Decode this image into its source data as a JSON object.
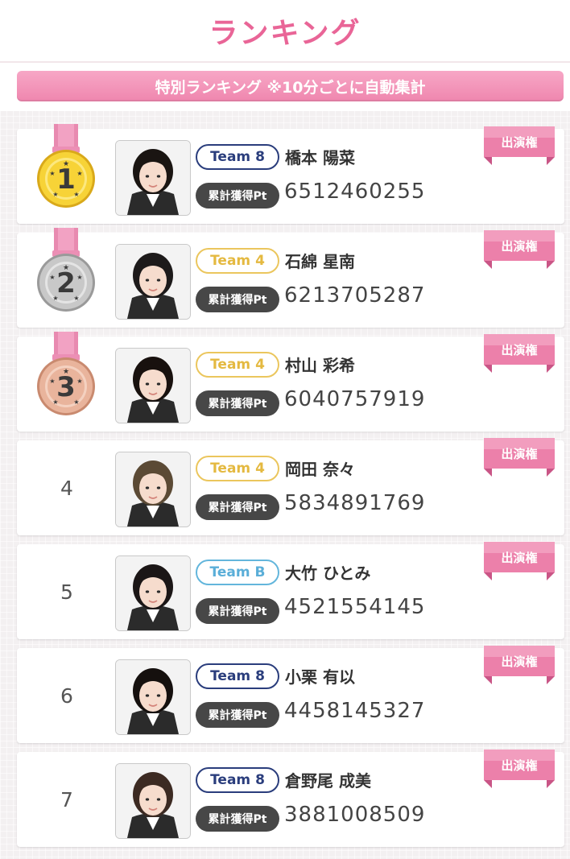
{
  "header": {
    "title": "ランキング"
  },
  "banner": {
    "text": "特別ランキング ※10分ごとに自動集計"
  },
  "colors": {
    "accent": "#e96597",
    "team8": "#2a3d7c",
    "team4": "#ebc65d",
    "teamB": "#63b6dc",
    "gold": "#f7d337",
    "silver": "#c8c8c8",
    "bronze": "#e9b49c"
  },
  "ranking": [
    {
      "rank": "1",
      "medal": "gold",
      "team": "Team 8",
      "team_class": "t8",
      "name": "橋本 陽菜",
      "pt_label": "累計獲得Pt",
      "points": "6512460255",
      "entitlement": "出演権"
    },
    {
      "rank": "2",
      "medal": "silver",
      "team": "Team 4",
      "team_class": "t4",
      "name": "石綿 星南",
      "pt_label": "累計獲得Pt",
      "points": "6213705287",
      "entitlement": "出演権"
    },
    {
      "rank": "3",
      "medal": "bronze",
      "team": "Team 4",
      "team_class": "t4",
      "name": "村山 彩希",
      "pt_label": "累計獲得Pt",
      "points": "6040757919",
      "entitlement": "出演権"
    },
    {
      "rank": "4",
      "medal": "",
      "team": "Team 4",
      "team_class": "t4",
      "name": "岡田 奈々",
      "pt_label": "累計獲得Pt",
      "points": "5834891769",
      "entitlement": "出演権"
    },
    {
      "rank": "5",
      "medal": "",
      "team": "Team B",
      "team_class": "tb",
      "name": "大竹 ひとみ",
      "pt_label": "累計獲得Pt",
      "points": "4521554145",
      "entitlement": "出演権"
    },
    {
      "rank": "6",
      "medal": "",
      "team": "Team 8",
      "team_class": "t8",
      "name": "小栗 有以",
      "pt_label": "累計獲得Pt",
      "points": "4458145327",
      "entitlement": "出演権"
    },
    {
      "rank": "7",
      "medal": "",
      "team": "Team 8",
      "team_class": "t8",
      "name": "倉野尾 成美",
      "pt_label": "累計獲得Pt",
      "points": "3881008509",
      "entitlement": "出演権"
    }
  ]
}
